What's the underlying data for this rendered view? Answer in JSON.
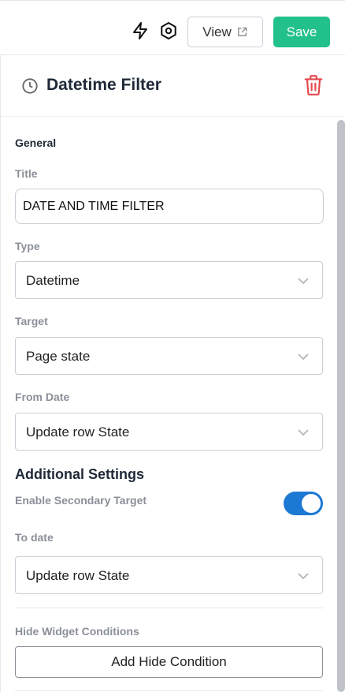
{
  "toolbar": {
    "lightning_icon": "lightning-icon",
    "settings_icon": "gear-icon",
    "view_label": "View",
    "view_icon": "external-link-icon",
    "save_label": "Save",
    "save_color": "#22c08a"
  },
  "panel": {
    "title": "Datetime Filter",
    "title_icon": "clock-icon",
    "delete_icon": "trash-icon",
    "delete_color": "#e5484d"
  },
  "general": {
    "heading": "General",
    "title_label": "Title",
    "title_value": "DATE AND TIME FILTER",
    "type_label": "Type",
    "type_value": "Datetime",
    "target_label": "Target",
    "target_value": "Page state",
    "from_date_label": "From Date",
    "from_date_value": "Update row State"
  },
  "additional": {
    "heading": "Additional Settings",
    "secondary_label": "Enable Secondary Target",
    "secondary_enabled": true,
    "toggle_color": "#1d78d4",
    "to_date_label": "To date",
    "to_date_value": "Update row State"
  },
  "hide": {
    "label": "Hide Widget Conditions",
    "add_label": "Add Hide Condition"
  }
}
